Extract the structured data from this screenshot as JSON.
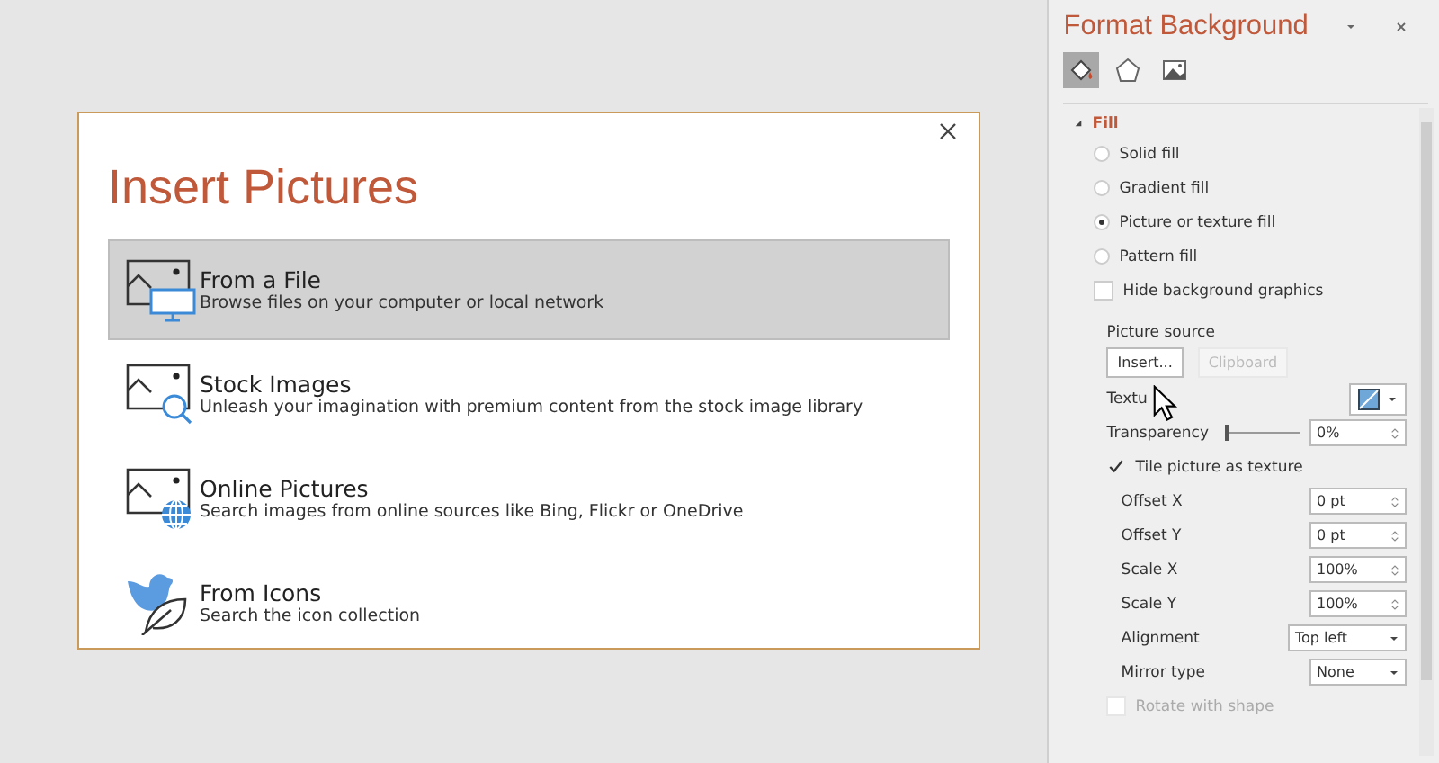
{
  "dialog": {
    "title": "Insert Pictures",
    "options": [
      {
        "kind": "file",
        "title": "From a File",
        "description": "Browse files on your computer or local network",
        "selected": true
      },
      {
        "kind": "stock",
        "title": "Stock Images",
        "description": "Unleash your imagination with premium content from the stock image library",
        "selected": false
      },
      {
        "kind": "online",
        "title": "Online Pictures",
        "description": "Search images from online sources like Bing, Flickr or OneDrive",
        "selected": false
      },
      {
        "kind": "icons",
        "title": "From Icons",
        "description": "Search the icon collection",
        "selected": false
      }
    ]
  },
  "panel": {
    "title": "Format Background",
    "tabs": [
      {
        "kind": "fill",
        "selected": true
      },
      {
        "kind": "effects",
        "selected": false
      },
      {
        "kind": "picture",
        "selected": false
      }
    ],
    "section": {
      "label": "Fill",
      "expanded": true
    },
    "fill_options": [
      {
        "label": "Solid fill",
        "selected": false
      },
      {
        "label": "Gradient fill",
        "selected": false
      },
      {
        "label": "Picture or texture fill",
        "selected": true
      },
      {
        "label": "Pattern fill",
        "selected": false
      }
    ],
    "hide_background": {
      "label": "Hide background graphics",
      "checked": false
    },
    "picture_source": {
      "label": "Picture source",
      "buttons": [
        {
          "label": "Insert...",
          "disabled": false
        },
        {
          "label": "Clipboard",
          "disabled": true
        }
      ]
    },
    "texture": {
      "label": "Textu"
    },
    "transparency": {
      "label": "Transparency",
      "level": 0,
      "value": "0%"
    },
    "tile": {
      "label": "Tile picture as texture",
      "checked": true
    },
    "spinners": [
      {
        "label": "Offset X",
        "value": "0 pt"
      },
      {
        "label": "Offset Y",
        "value": "0 pt"
      },
      {
        "label": "Scale X",
        "value": "100%"
      },
      {
        "label": "Scale Y",
        "value": "100%"
      }
    ],
    "dropdowns": [
      {
        "label": "Alignment",
        "value": "Top left"
      },
      {
        "label": "Mirror type",
        "value": "None"
      }
    ],
    "rotate": {
      "label": "Rotate with shape",
      "checked": false,
      "disabled": true
    }
  }
}
